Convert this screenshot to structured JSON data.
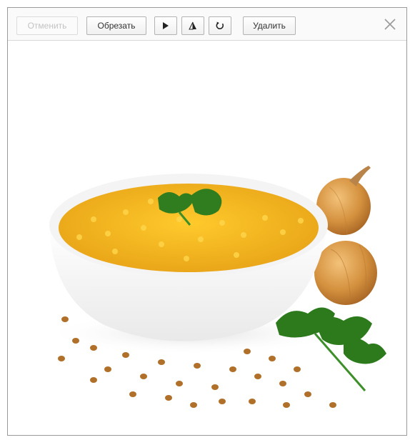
{
  "toolbar": {
    "apply_label": "Отменить",
    "crop_label": "Обрезать",
    "delete_label": "Удалить",
    "icons": [
      "flip-horizontal-icon",
      "flip-vertical-icon",
      "rotate-icon",
      "close-icon"
    ]
  },
  "image": {
    "subject": "bowl-of-lentil-soup-with-onions-and-parsley",
    "colors": {
      "soup": "#f2b21a",
      "bowl": "#ffffff",
      "onion": "#d99a45",
      "parsley": "#2f7d1e",
      "lentil": "#b0702a"
    }
  }
}
